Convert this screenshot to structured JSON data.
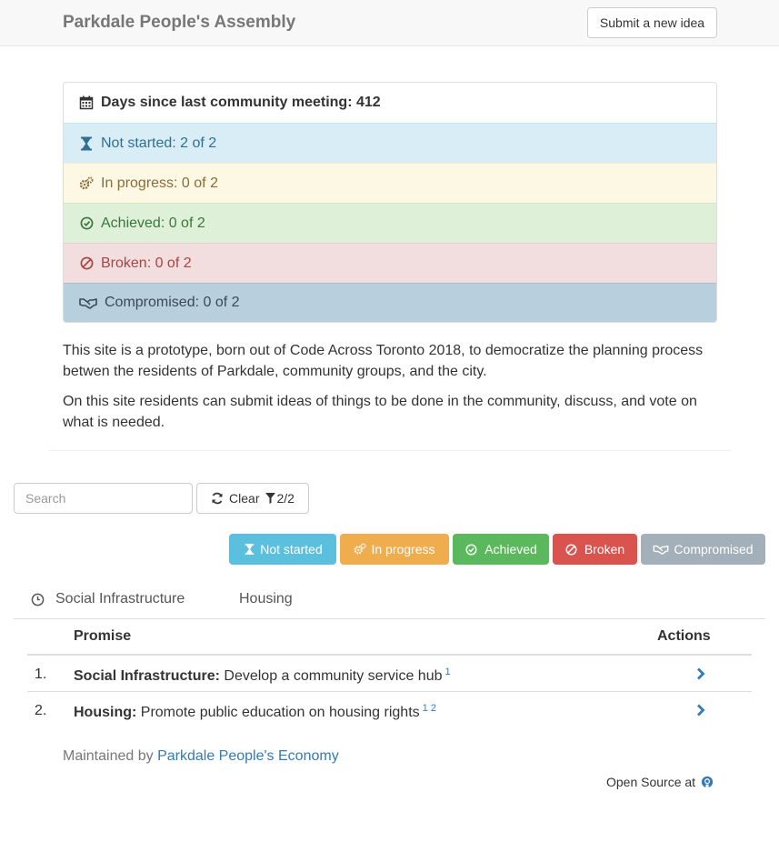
{
  "navbar": {
    "brand": "Parkdale People's Assembly",
    "submit_label": "Submit a new idea"
  },
  "summary": {
    "days_label": "Days since last community meeting: 412",
    "rows": [
      {
        "label": "Not started: 2 of 2",
        "icon": "hourglass-icon"
      },
      {
        "label": "In progress: 0 of 2",
        "icon": "gears-icon"
      },
      {
        "label": "Achieved: 0 of 2",
        "icon": "check-circle-icon"
      },
      {
        "label": "Broken: 0 of 2",
        "icon": "ban-icon"
      },
      {
        "label": "Compromised: 0 of 2",
        "icon": "handshake-icon"
      }
    ]
  },
  "description": [
    "This site is a prototype, born out of Code Across Toronto 2018, to democratize the planning process betwen the residents of Parkdale, community groups, and the city.",
    "On this site residents can submit ideas of things to be done in the community, discuss, and vote on what is needed."
  ],
  "filters": {
    "search_placeholder": "Search",
    "clear_label": "Clear",
    "filter_count": "2/2",
    "buttons": [
      {
        "label": "Not started",
        "color": "#5bc0de"
      },
      {
        "label": "In progress",
        "color": "#f0ad4e"
      },
      {
        "label": "Achieved",
        "color": "#5cb85c"
      },
      {
        "label": "Broken",
        "color": "#d9534f"
      },
      {
        "label": "Compromised",
        "color": "#a4b0b9"
      }
    ]
  },
  "tabs": [
    {
      "label": "Social Infrastructure"
    },
    {
      "label": "Housing"
    }
  ],
  "table": {
    "headers": {
      "promise": "Promise",
      "actions": "Actions"
    },
    "rows": [
      {
        "num": "1.",
        "category": "Social Infrastructure:",
        "text": "Develop a community service hub",
        "refs": "1"
      },
      {
        "num": "2.",
        "category": "Housing:",
        "text": "Promote public education on housing rights",
        "refs": "1 2"
      }
    ]
  },
  "footer": {
    "maintained_prefix": "Maintained by",
    "maintained_link": "Parkdale People's Economy",
    "open_source": "Open Source at"
  }
}
